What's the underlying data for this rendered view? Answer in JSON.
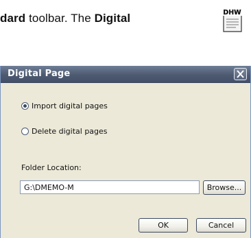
{
  "doc": {
    "text_parts": [
      "dard",
      " toolbar. The ",
      "Digital"
    ],
    "icon_label": "DHW"
  },
  "dialog": {
    "title": "Digital Page",
    "options": [
      {
        "label": "Import digital pages",
        "checked": true
      },
      {
        "label": "Delete digital pages",
        "checked": false
      }
    ],
    "folder_label": "Folder Location:",
    "folder_value": "G:\\DMEMO-M",
    "browse_label": "Browse...",
    "ok_label": "OK",
    "cancel_label": "Cancel"
  },
  "colors": {
    "titlebar": "#56627a",
    "dialog_bg": "#ece9d8"
  }
}
